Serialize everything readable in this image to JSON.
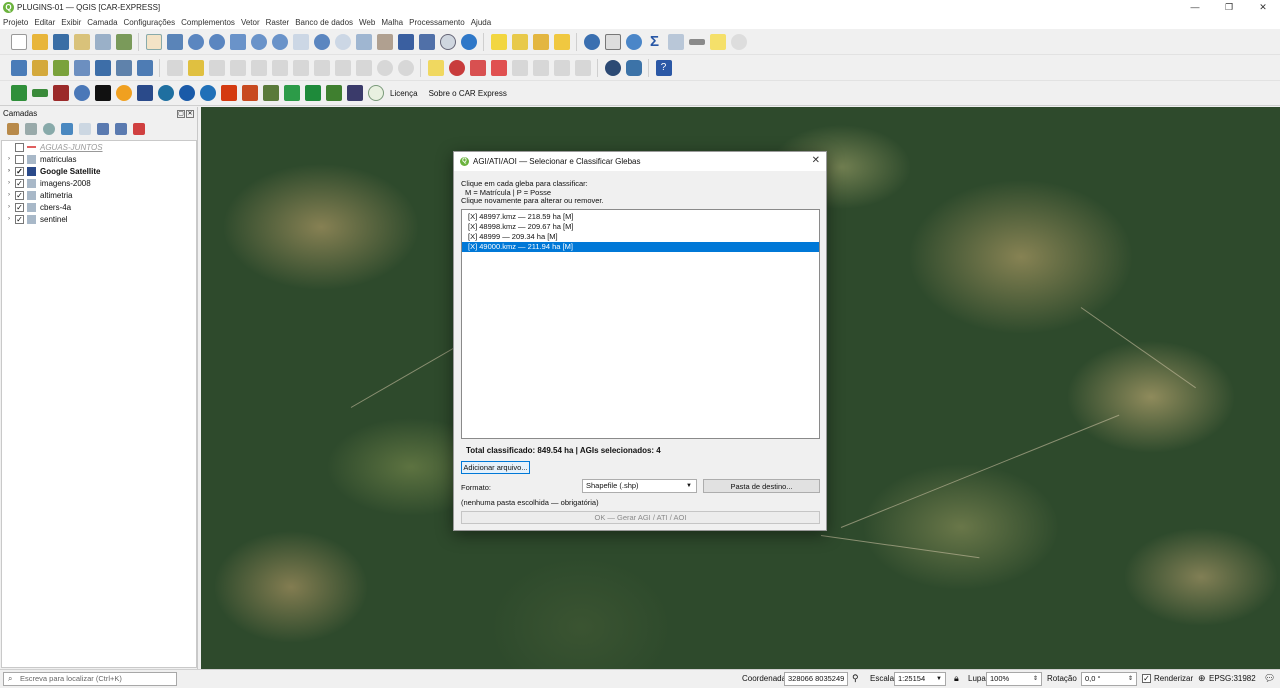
{
  "window": {
    "title": "PLUGINS-01 — QGIS [CAR-EXPRESS]",
    "app_icon": "Q"
  },
  "menu": [
    "Projeto",
    "Editar",
    "Exibir",
    "Camada",
    "Configurações",
    "Complementos",
    "Vetor",
    "Raster",
    "Banco de dados",
    "Web",
    "Malha",
    "Processamento",
    "Ajuda"
  ],
  "plugin_toolbar": {
    "licence_label": "Licença",
    "about_label": "Sobre o CAR Express"
  },
  "layers_panel": {
    "title": "Camadas",
    "items": [
      {
        "label": "AGUAS-JUNTOS",
        "checked": false,
        "expandable": false,
        "style": "dim"
      },
      {
        "label": "matriculas",
        "checked": false,
        "expandable": true,
        "style": "normal"
      },
      {
        "label": "Google Satellite",
        "checked": true,
        "expandable": true,
        "style": "bold"
      },
      {
        "label": "imagens-2008",
        "checked": true,
        "expandable": true,
        "style": "normal"
      },
      {
        "label": "altimetria",
        "checked": true,
        "expandable": true,
        "style": "normal"
      },
      {
        "label": "cbers-4a",
        "checked": true,
        "expandable": true,
        "style": "normal"
      },
      {
        "label": "sentinel",
        "checked": true,
        "expandable": true,
        "style": "normal"
      }
    ]
  },
  "dialog": {
    "title": "AGI/ATI/AOI — Selecionar e Classificar Glebas",
    "instr_line1": "Clique em cada gleba para classificar:",
    "instr_line2": "M = Matrícula  |  P = Posse",
    "instr_line3": "Clique novamente para alterar ou remover.",
    "items": [
      {
        "text": "[X] 48997.kmz  —  218.59 ha  [M]",
        "selected": false
      },
      {
        "text": "[X] 48998.kmz  —  209.67 ha  [M]",
        "selected": false
      },
      {
        "text": "[X] 48999  —  209.34 ha  [M]",
        "selected": false
      },
      {
        "text": "[X] 49000.kmz  —  211.94 ha  [M]",
        "selected": true
      }
    ],
    "total": "Total classificado: 849.54 ha  |  AGIs selecionados: 4",
    "add_file_label": "Adicionar arquivo...",
    "format_label": "Formato:",
    "format_value": "Shapefile (.shp)",
    "dest_folder_label": "Pasta de destino...",
    "dest_status": "(nenhuma pasta escolhida — obrigatória)",
    "ok_label": "OK — Gerar AGI / ATI / AOI"
  },
  "statusbar": {
    "locator_placeholder": "Escreva para localizar (Ctrl+K)",
    "coord_label": "Coordenada",
    "coord_value": "328066  8035249",
    "scale_label": "Escala",
    "scale_value": "1:25154",
    "magnifier_label": "Lupa",
    "magnifier_value": "100%",
    "rotation_label": "Rotação",
    "rotation_value": "0,0 °",
    "render_label": "Renderizar",
    "render_checked": true,
    "crs": "EPSG:31982"
  },
  "colors": {
    "accent": "#0078d7",
    "qgis_green": "#6bb33d",
    "map_base": "#2e4a2c"
  }
}
